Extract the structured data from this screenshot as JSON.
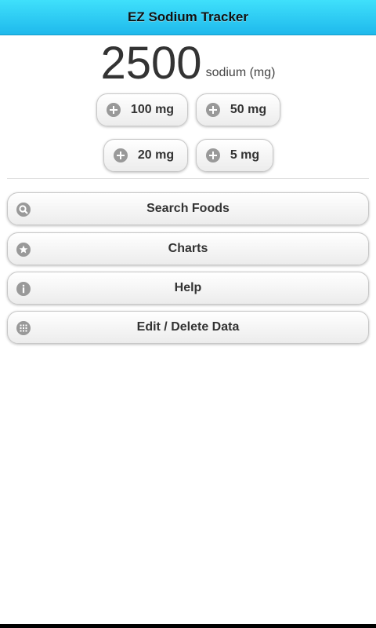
{
  "header": {
    "title": "EZ Sodium Tracker"
  },
  "total": {
    "value": "2500",
    "unit": "sodium (mg)"
  },
  "add_buttons": [
    {
      "label": "100 mg",
      "icon": "plus-icon"
    },
    {
      "label": "50 mg",
      "icon": "plus-icon"
    },
    {
      "label": "20 mg",
      "icon": "plus-icon"
    },
    {
      "label": "5 mg",
      "icon": "plus-icon"
    }
  ],
  "menu": [
    {
      "label": "Search Foods",
      "icon": "search-icon"
    },
    {
      "label": "Charts",
      "icon": "star-icon"
    },
    {
      "label": "Help",
      "icon": "info-icon"
    },
    {
      "label": "Edit / Delete Data",
      "icon": "grid-icon"
    }
  ],
  "colors": {
    "header_top": "#3fe0fb",
    "header_bottom": "#1fb9ec",
    "icon_gray": "#999999",
    "text": "#333333"
  }
}
